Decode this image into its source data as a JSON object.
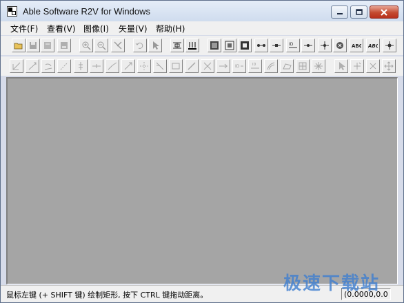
{
  "window": {
    "title": "Able Software R2V for Windows"
  },
  "menu": [
    {
      "label": "文件(F)"
    },
    {
      "label": "查看(V)"
    },
    {
      "label": "图像(I)"
    },
    {
      "label": "矢量(V)"
    },
    {
      "label": "帮助(H)"
    }
  ],
  "toolbar1": [
    {
      "icon": "open-folder-icon"
    },
    {
      "icon": "save-disk-icon"
    },
    {
      "icon": "open-vector-icon"
    },
    {
      "icon": "save-vector-icon"
    },
    {
      "icon": "zoom-in-icon"
    },
    {
      "icon": "zoom-out-icon"
    },
    {
      "icon": "pan-icon"
    },
    {
      "icon": "undo-icon"
    },
    {
      "icon": "select-arrow-icon"
    },
    {
      "icon": "threshold-icon"
    },
    {
      "icon": "trace-icon"
    },
    {
      "icon": "image-frame-icon"
    },
    {
      "icon": "crop-icon"
    },
    {
      "icon": "solid-frame-icon"
    },
    {
      "icon": "node-line-icon"
    },
    {
      "icon": "node-segment-icon"
    },
    {
      "icon": "id-node-icon"
    },
    {
      "icon": "point-icon"
    },
    {
      "icon": "cross-point-icon"
    },
    {
      "icon": "delete-point-icon"
    },
    {
      "icon": "text-abc-icon"
    },
    {
      "icon": "text-abc-italic-icon"
    },
    {
      "icon": "star-point-icon"
    }
  ],
  "toolbar2": [
    {
      "icon": "edit-line-icon"
    },
    {
      "icon": "draw-line-icon"
    },
    {
      "icon": "rotate-line-icon"
    },
    {
      "icon": "dashed-line-icon"
    },
    {
      "icon": "split-line-icon"
    },
    {
      "icon": "join-line-icon"
    },
    {
      "icon": "angle-line-icon"
    },
    {
      "icon": "extend-line-icon"
    },
    {
      "icon": "snap-node-icon"
    },
    {
      "icon": "cut-line-icon"
    },
    {
      "icon": "rectangle-icon"
    },
    {
      "icon": "diagonal-icon"
    },
    {
      "icon": "diagonal-cross-icon"
    },
    {
      "icon": "arrow-line-icon"
    },
    {
      "icon": "id-label-icon"
    },
    {
      "icon": "id-line-icon"
    },
    {
      "icon": "contour-icon"
    },
    {
      "icon": "area-icon"
    },
    {
      "icon": "tile-icon"
    },
    {
      "icon": "spark-icon"
    },
    {
      "icon": "pointer-icon"
    },
    {
      "icon": "add-node-icon"
    },
    {
      "icon": "remove-node-icon"
    },
    {
      "icon": "move-all-icon"
    }
  ],
  "status": {
    "message": "鼠标左键 (+ SHIFT 键) 绘制矩形, 按下 CTRL 键拖动距离。",
    "coords": "(0.0000,0.0"
  },
  "watermark": "极速下载站"
}
